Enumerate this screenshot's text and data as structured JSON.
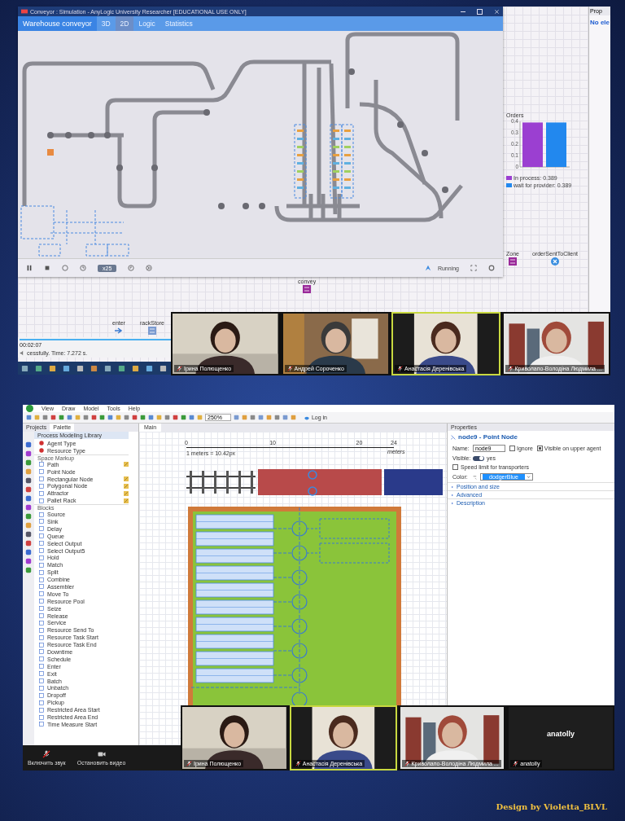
{
  "top_screen": {
    "editor": {
      "properties_tab": "Prop",
      "properties_message": "No ele",
      "chart": {
        "chart_data": {
          "type": "bar",
          "title": "Orders",
          "ylim": [
            0,
            0.4
          ],
          "yticks": [
            0,
            0.1,
            0.2,
            0.3,
            0.4
          ],
          "legend": "bottom",
          "series": [
            {
              "name": "In process: 0.389",
              "color": "#9b3fd1",
              "values": [
                0.39
              ]
            },
            {
              "name": "wait for provider: 0.389",
              "color": "#2288ee",
              "values": [
                0.39
              ]
            }
          ]
        }
      },
      "blocks": [
        {
          "label": "convey"
        },
        {
          "label": "enter"
        },
        {
          "label": "rackStore"
        },
        {
          "label": "Zone"
        },
        {
          "label": "orderSentToClient"
        }
      ],
      "console_time": "00:02:07",
      "console_message": "cessfully. Time: 7.272 s."
    },
    "simulation": {
      "title": "Conveyor : Simulation - AnyLogic University Researcher [EDUCATIONAL USE ONLY]",
      "model_name": "Warehouse conveyor",
      "tabs": [
        {
          "label": "3D",
          "selected": false
        },
        {
          "label": "2D",
          "selected": true
        },
        {
          "label": "Logic",
          "selected": false
        },
        {
          "label": "Statistics",
          "selected": false
        }
      ],
      "speed": "x25",
      "status": "Running"
    },
    "participants": [
      {
        "name": "Ірина Полющенко",
        "active": false,
        "video": true
      },
      {
        "name": "Андрей Сороченко",
        "active": false,
        "video": true
      },
      {
        "name": "Анастасія Деренівська",
        "active": true,
        "video": true
      },
      {
        "name": "Криволапо-Володіна Людмила ...",
        "active": false,
        "video": true
      }
    ]
  },
  "bottom_screen": {
    "menu": [
      "View",
      "Draw",
      "Model",
      "Tools",
      "Help"
    ],
    "zoom": "250%",
    "login": "Log in",
    "side_tabs": [
      {
        "label": "Projects",
        "selected": false
      },
      {
        "label": "Palette",
        "selected": true
      }
    ],
    "library": "Process Modeling Library",
    "palette": [
      {
        "kind": "item",
        "label": "Agent Type",
        "editable": false
      },
      {
        "kind": "item",
        "label": "Resource Type",
        "editable": false
      },
      {
        "kind": "section",
        "label": "Space Markup"
      },
      {
        "kind": "item",
        "label": "Path",
        "editable": true
      },
      {
        "kind": "item",
        "label": "Point Node",
        "editable": false
      },
      {
        "kind": "item",
        "label": "Rectangular Node",
        "editable": true
      },
      {
        "kind": "item",
        "label": "Polygonal Node",
        "editable": true
      },
      {
        "kind": "item",
        "label": "Attractor",
        "editable": true
      },
      {
        "kind": "item",
        "label": "Pallet Rack",
        "editable": true
      },
      {
        "kind": "section",
        "label": "Blocks"
      },
      {
        "kind": "item",
        "label": "Source",
        "editable": false
      },
      {
        "kind": "item",
        "label": "Sink",
        "editable": false
      },
      {
        "kind": "item",
        "label": "Delay",
        "editable": false
      },
      {
        "kind": "item",
        "label": "Queue",
        "editable": false
      },
      {
        "kind": "item",
        "label": "Select Output",
        "editable": false
      },
      {
        "kind": "item",
        "label": "Select Output5",
        "editable": false
      },
      {
        "kind": "item",
        "label": "Hold",
        "editable": false
      },
      {
        "kind": "item",
        "label": "Match",
        "editable": false
      },
      {
        "kind": "item",
        "label": "Split",
        "editable": false
      },
      {
        "kind": "item",
        "label": "Combine",
        "editable": false
      },
      {
        "kind": "item",
        "label": "Assembler",
        "editable": false
      },
      {
        "kind": "item",
        "label": "Move To",
        "editable": false
      },
      {
        "kind": "item",
        "label": "Resource Pool",
        "editable": false
      },
      {
        "kind": "item",
        "label": "Seize",
        "editable": false
      },
      {
        "kind": "item",
        "label": "Release",
        "editable": false
      },
      {
        "kind": "item",
        "label": "Service",
        "editable": false
      },
      {
        "kind": "item",
        "label": "Resource Send To",
        "editable": false
      },
      {
        "kind": "item",
        "label": "Resource Task Start",
        "editable": false
      },
      {
        "kind": "item",
        "label": "Resource Task End",
        "editable": false
      },
      {
        "kind": "item",
        "label": "Downtime",
        "editable": false
      },
      {
        "kind": "item",
        "label": "Schedule",
        "editable": false
      },
      {
        "kind": "item",
        "label": "Enter",
        "editable": false
      },
      {
        "kind": "item",
        "label": "Exit",
        "editable": false
      },
      {
        "kind": "item",
        "label": "Batch",
        "editable": false
      },
      {
        "kind": "item",
        "label": "Unbatch",
        "editable": false
      },
      {
        "kind": "item",
        "label": "Dropoff",
        "editable": false
      },
      {
        "kind": "item",
        "label": "Pickup",
        "editable": false
      },
      {
        "kind": "item",
        "label": "Restricted Area Start",
        "editable": false
      },
      {
        "kind": "item",
        "label": "Restricted Area End",
        "editable": false
      },
      {
        "kind": "item",
        "label": "Time Measure Start",
        "editable": false
      }
    ],
    "editor_tab": "Main",
    "ruler": {
      "ticks": [
        "0",
        "10",
        "20",
        "24"
      ],
      "unit": "meters",
      "scale": "1 meters = 10.42px"
    },
    "properties": {
      "tab": "Properties",
      "heading": "node9 - Point Node",
      "name_label": "Name:",
      "name_value": "node9",
      "checks": [
        {
          "label": "Ignore",
          "checked": false
        },
        {
          "label": "Visible on upper agent",
          "checked": true
        }
      ],
      "visible_label": "Visible:",
      "visible_value": "yes",
      "visible_on": true,
      "speed_limit": {
        "label": "Speed limit for transporters",
        "checked": false
      },
      "color_label": "Color:",
      "color_value": "dodgerBlue",
      "sections": [
        "Position and size",
        "Advanced",
        "Description"
      ]
    },
    "participants": [
      {
        "name": "Ірина Полющенко",
        "active": false,
        "video": true
      },
      {
        "name": "Анастасія Деренівська",
        "active": true,
        "video": true
      },
      {
        "name": "Криволапо-Володіна Людмила ...",
        "active": false,
        "video": true
      },
      {
        "name": "anatolly",
        "active": false,
        "video": false,
        "display_name": "anatolly"
      }
    ],
    "call_controls": [
      {
        "label": "Включить звук",
        "kind": "mic"
      },
      {
        "label": "Остановить видео",
        "kind": "camera"
      }
    ]
  },
  "credit": "Design by Violetta_BLVL"
}
